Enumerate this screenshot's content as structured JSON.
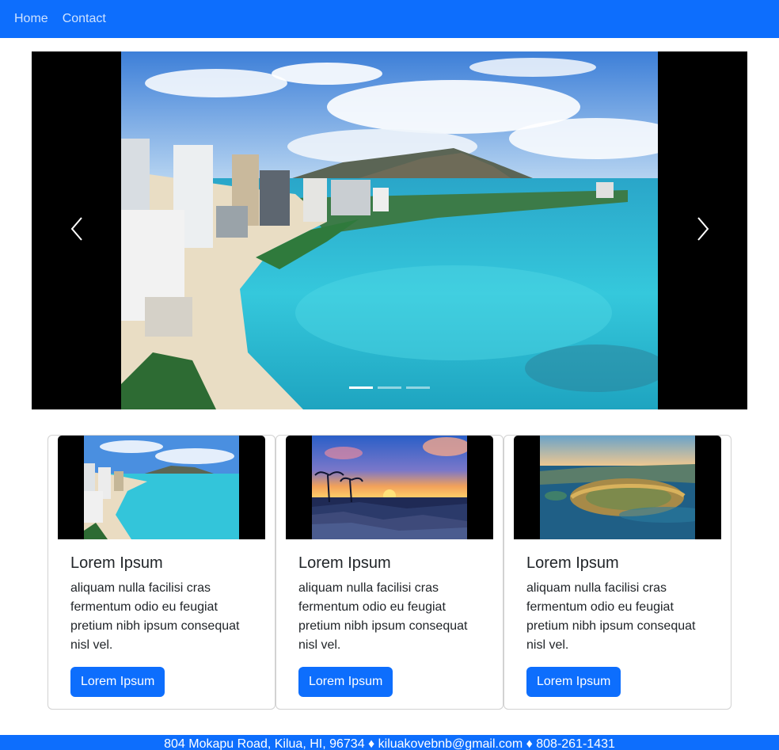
{
  "navbar": {
    "links": [
      "Home",
      "Contact"
    ],
    "color": "#0d6efd"
  },
  "carousel": {
    "prev_icon": "chevron-left-icon",
    "next_icon": "chevron-right-icon",
    "slides": [
      "waikiki-beach-diamond-head",
      "sunset-coast",
      "diamond-head-crater"
    ],
    "active_index": 0
  },
  "cards": [
    {
      "image": "waikiki-beach",
      "title": "Lorem Ipsum",
      "text": "aliquam nulla facilisi cras fermentum odio eu feugiat pretium nibh ipsum consequat nisl vel.",
      "button": "Lorem Ipsum"
    },
    {
      "image": "sunset-coast",
      "title": "Lorem Ipsum",
      "text": "aliquam nulla facilisi cras fermentum odio eu feugiat pretium nibh ipsum consequat nisl vel.",
      "button": "Lorem Ipsum"
    },
    {
      "image": "diamond-head-crater",
      "title": "Lorem Ipsum",
      "text": "aliquam nulla facilisi cras fermentum odio eu feugiat pretium nibh ipsum consequat nisl vel.",
      "button": "Lorem Ipsum"
    }
  ],
  "footer": {
    "text": "804 Mokapu Road, Kilua, HI, 96734 ♦ kiluakovebnb@gmail.com ♦ 808-261-1431"
  },
  "colors": {
    "primary": "#0d6efd",
    "ocean": "#2fc6dc",
    "sky": "#4a8fe0"
  }
}
